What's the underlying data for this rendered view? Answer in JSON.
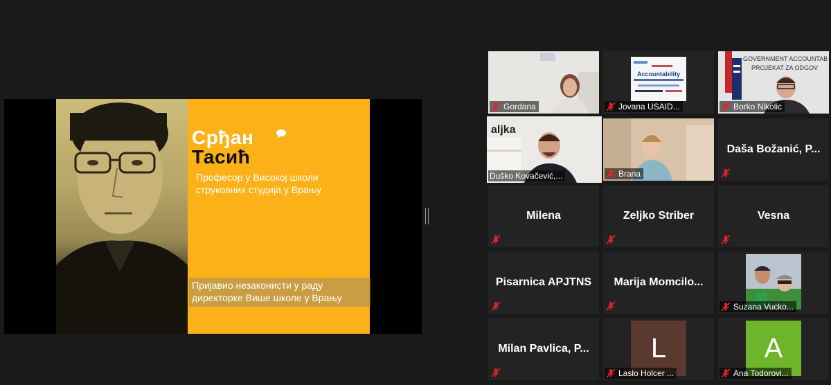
{
  "share": {
    "first_name": "Срђан",
    "last_name": "Тасић",
    "subtitle": "Професор у Високој школи струковних студија у Врању",
    "caption": "Пријавио незаконисти у раду директорке Више школе у Врању"
  },
  "participants": {
    "gordana": "Gordana",
    "jovana": "Jovana USAID...",
    "borko": "Borko Nikolic",
    "dusko": "Duško Kovačević,...",
    "brana": "Brana",
    "dasa": "Daša Božanić, P...",
    "milena": "Milena",
    "zeljko": "Zeljko Striber",
    "vesna": "Vesna",
    "pisarnica": "Pisarnica APJTNS",
    "marija": "Marija Momcilo...",
    "suzana": "Suzana Vucko...",
    "milan": "Milan Pavlica, P...",
    "laslo": "Laslo Holcer ...",
    "ana": "Ana Todorovi...",
    "laslo_initial": "L",
    "ana_initial": "A",
    "jovana_slide": "Accountability",
    "borko_banner_1": "GOVERNMENT ACCOUNTAB",
    "borko_banner_2": "PROJEKAT ZA ODGOV",
    "dusko_bg_text": "alјka"
  },
  "colors": {
    "slide_yellow": "#fbb117",
    "active_border": "#b8d92a",
    "mute_red": "#e0242c",
    "laslo_avatar": "#5a3a2e",
    "ana_avatar": "#6fb52c"
  }
}
